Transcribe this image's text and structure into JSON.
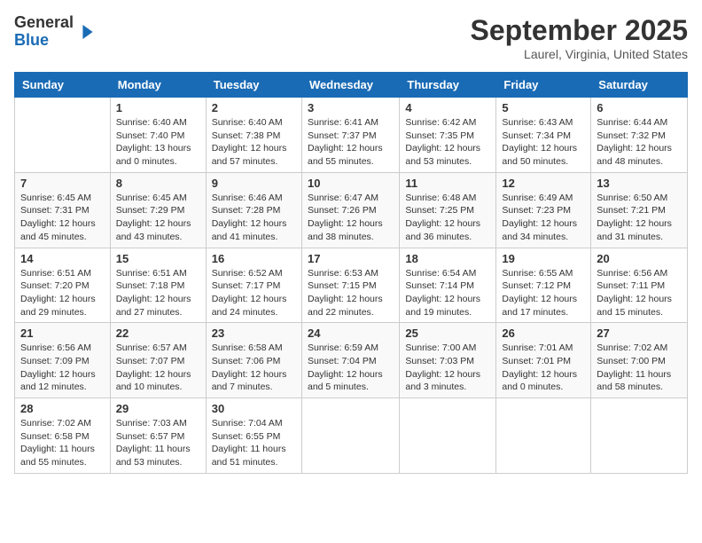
{
  "header": {
    "logo": {
      "general": "General",
      "blue": "Blue"
    },
    "title": "September 2025",
    "location": "Laurel, Virginia, United States"
  },
  "days_of_week": [
    "Sunday",
    "Monday",
    "Tuesday",
    "Wednesday",
    "Thursday",
    "Friday",
    "Saturday"
  ],
  "weeks": [
    [
      {
        "day": "",
        "info": ""
      },
      {
        "day": "1",
        "info": "Sunrise: 6:40 AM\nSunset: 7:40 PM\nDaylight: 13 hours\nand 0 minutes."
      },
      {
        "day": "2",
        "info": "Sunrise: 6:40 AM\nSunset: 7:38 PM\nDaylight: 12 hours\nand 57 minutes."
      },
      {
        "day": "3",
        "info": "Sunrise: 6:41 AM\nSunset: 7:37 PM\nDaylight: 12 hours\nand 55 minutes."
      },
      {
        "day": "4",
        "info": "Sunrise: 6:42 AM\nSunset: 7:35 PM\nDaylight: 12 hours\nand 53 minutes."
      },
      {
        "day": "5",
        "info": "Sunrise: 6:43 AM\nSunset: 7:34 PM\nDaylight: 12 hours\nand 50 minutes."
      },
      {
        "day": "6",
        "info": "Sunrise: 6:44 AM\nSunset: 7:32 PM\nDaylight: 12 hours\nand 48 minutes."
      }
    ],
    [
      {
        "day": "7",
        "info": "Sunrise: 6:45 AM\nSunset: 7:31 PM\nDaylight: 12 hours\nand 45 minutes."
      },
      {
        "day": "8",
        "info": "Sunrise: 6:45 AM\nSunset: 7:29 PM\nDaylight: 12 hours\nand 43 minutes."
      },
      {
        "day": "9",
        "info": "Sunrise: 6:46 AM\nSunset: 7:28 PM\nDaylight: 12 hours\nand 41 minutes."
      },
      {
        "day": "10",
        "info": "Sunrise: 6:47 AM\nSunset: 7:26 PM\nDaylight: 12 hours\nand 38 minutes."
      },
      {
        "day": "11",
        "info": "Sunrise: 6:48 AM\nSunset: 7:25 PM\nDaylight: 12 hours\nand 36 minutes."
      },
      {
        "day": "12",
        "info": "Sunrise: 6:49 AM\nSunset: 7:23 PM\nDaylight: 12 hours\nand 34 minutes."
      },
      {
        "day": "13",
        "info": "Sunrise: 6:50 AM\nSunset: 7:21 PM\nDaylight: 12 hours\nand 31 minutes."
      }
    ],
    [
      {
        "day": "14",
        "info": "Sunrise: 6:51 AM\nSunset: 7:20 PM\nDaylight: 12 hours\nand 29 minutes."
      },
      {
        "day": "15",
        "info": "Sunrise: 6:51 AM\nSunset: 7:18 PM\nDaylight: 12 hours\nand 27 minutes."
      },
      {
        "day": "16",
        "info": "Sunrise: 6:52 AM\nSunset: 7:17 PM\nDaylight: 12 hours\nand 24 minutes."
      },
      {
        "day": "17",
        "info": "Sunrise: 6:53 AM\nSunset: 7:15 PM\nDaylight: 12 hours\nand 22 minutes."
      },
      {
        "day": "18",
        "info": "Sunrise: 6:54 AM\nSunset: 7:14 PM\nDaylight: 12 hours\nand 19 minutes."
      },
      {
        "day": "19",
        "info": "Sunrise: 6:55 AM\nSunset: 7:12 PM\nDaylight: 12 hours\nand 17 minutes."
      },
      {
        "day": "20",
        "info": "Sunrise: 6:56 AM\nSunset: 7:11 PM\nDaylight: 12 hours\nand 15 minutes."
      }
    ],
    [
      {
        "day": "21",
        "info": "Sunrise: 6:56 AM\nSunset: 7:09 PM\nDaylight: 12 hours\nand 12 minutes."
      },
      {
        "day": "22",
        "info": "Sunrise: 6:57 AM\nSunset: 7:07 PM\nDaylight: 12 hours\nand 10 minutes."
      },
      {
        "day": "23",
        "info": "Sunrise: 6:58 AM\nSunset: 7:06 PM\nDaylight: 12 hours\nand 7 minutes."
      },
      {
        "day": "24",
        "info": "Sunrise: 6:59 AM\nSunset: 7:04 PM\nDaylight: 12 hours\nand 5 minutes."
      },
      {
        "day": "25",
        "info": "Sunrise: 7:00 AM\nSunset: 7:03 PM\nDaylight: 12 hours\nand 3 minutes."
      },
      {
        "day": "26",
        "info": "Sunrise: 7:01 AM\nSunset: 7:01 PM\nDaylight: 12 hours\nand 0 minutes."
      },
      {
        "day": "27",
        "info": "Sunrise: 7:02 AM\nSunset: 7:00 PM\nDaylight: 11 hours\nand 58 minutes."
      }
    ],
    [
      {
        "day": "28",
        "info": "Sunrise: 7:02 AM\nSunset: 6:58 PM\nDaylight: 11 hours\nand 55 minutes."
      },
      {
        "day": "29",
        "info": "Sunrise: 7:03 AM\nSunset: 6:57 PM\nDaylight: 11 hours\nand 53 minutes."
      },
      {
        "day": "30",
        "info": "Sunrise: 7:04 AM\nSunset: 6:55 PM\nDaylight: 11 hours\nand 51 minutes."
      },
      {
        "day": "",
        "info": ""
      },
      {
        "day": "",
        "info": ""
      },
      {
        "day": "",
        "info": ""
      },
      {
        "day": "",
        "info": ""
      }
    ]
  ]
}
